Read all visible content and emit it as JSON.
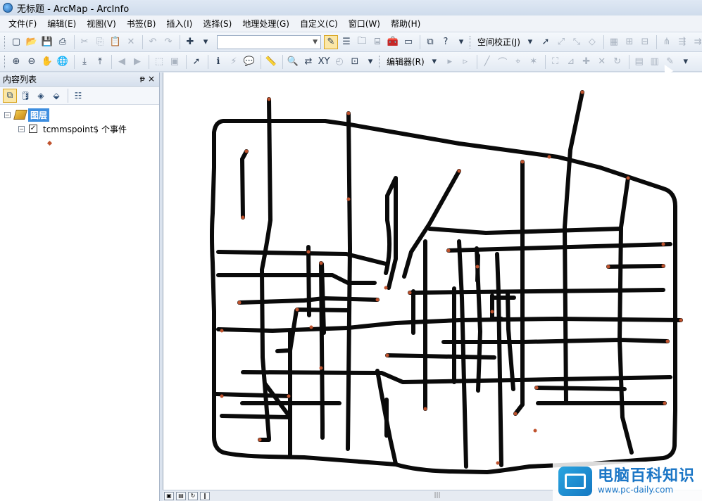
{
  "window": {
    "title": "无标题 - ArcMap - ArcInfo"
  },
  "menu": [
    "文件(F)",
    "编辑(E)",
    "视图(V)",
    "书签(B)",
    "插入(I)",
    "选择(S)",
    "地理处理(G)",
    "自定义(C)",
    "窗口(W)",
    "帮助(H)"
  ],
  "toolbar": {
    "scale_value": "",
    "spatial_adjust_label": "空间校正(J)",
    "editor_label": "编辑器(R)"
  },
  "toc": {
    "title": "内容列表",
    "pin_glyph": "ᵽ",
    "close_glyph": "×",
    "group_label": "图层",
    "layer_label": "tcmmspoint$ 个事件",
    "layer_checked": "✓"
  },
  "icons": {
    "new": "▢",
    "open": "📂",
    "save": "💾",
    "print": "⎙",
    "cut": "✂",
    "copy": "⎘",
    "paste": "📋",
    "delete": "✕",
    "undo": "↶",
    "redo": "↷",
    "add_data": "✚"
  },
  "colors": {
    "road": "#0a0a0a",
    "point": "#c0532e",
    "selection": "#3d8ee0"
  },
  "watermark": {
    "title": "电脑百科知识",
    "url": "www.pc-daily.com"
  }
}
